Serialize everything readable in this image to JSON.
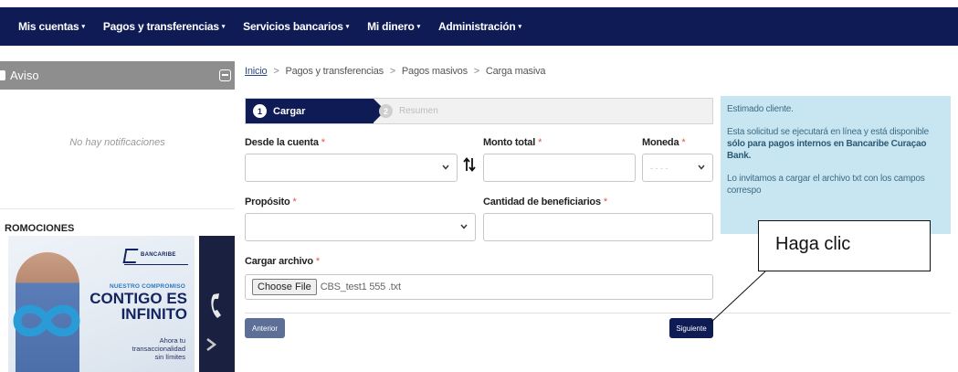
{
  "nav": {
    "items": [
      {
        "label": "Mis cuentas",
        "caret": "▾"
      },
      {
        "label": "Pagos y transferencias",
        "caret": "▾"
      },
      {
        "label": "Servicios bancarios",
        "caret": "▾"
      },
      {
        "label": "Mi dinero",
        "caret": "▾"
      },
      {
        "label": "Administración",
        "caret": "▾"
      }
    ]
  },
  "sidebar": {
    "aviso_title": "Aviso",
    "no_notifications": "No hay notificaciones",
    "promos_title": "ROMOCIONES",
    "promo": {
      "logo_text": "BANCARIBE",
      "sub": "NUESTRO COMPROMISO",
      "headline_1": "CONTIGO ES",
      "headline_2": "INFINITO",
      "small_1": "Ahora tu",
      "small_2": "transaccionalidad",
      "small_3": "sin límites"
    }
  },
  "breadcrumb": {
    "home": "Inicio",
    "items": [
      "Pagos y transferencias",
      "Pagos masivos",
      "Carga masiva"
    ],
    "separator": ">"
  },
  "stepper": {
    "steps": [
      {
        "num": "1",
        "label": "Cargar",
        "active": true
      },
      {
        "num": "2",
        "label": "Resumen",
        "active": false
      }
    ]
  },
  "form": {
    "desde_label": "Desde la cuenta",
    "monto_label": "Monto total",
    "moneda_label": "Moneda",
    "proposito_label": "Propósito",
    "cantidad_label": "Cantidad de beneficiarios",
    "archivo_label": "Cargar archivo",
    "required_mark": "*",
    "moneda_placeholder": "- - - -",
    "choose_file": "Choose File",
    "file_name": "CBS_test1 555 .txt"
  },
  "buttons": {
    "prev": "Anterior",
    "next": "Siguiente"
  },
  "info": {
    "line_1": "Estimado cliente.",
    "line_2_a": "Esta solicitud se ejecutará en línea y está disponible ",
    "line_2_b": "sólo para pagos internos en Bancaribe Curaçao Bank.",
    "line_3": "Lo invitamos a cargar el archivo txt con los campos correspo"
  },
  "annotation": {
    "callout_text": "Haga clic"
  },
  "colors": {
    "nav_bg": "#0e1b55",
    "info_bg": "#c7e6f1",
    "required": "#e0524d"
  }
}
